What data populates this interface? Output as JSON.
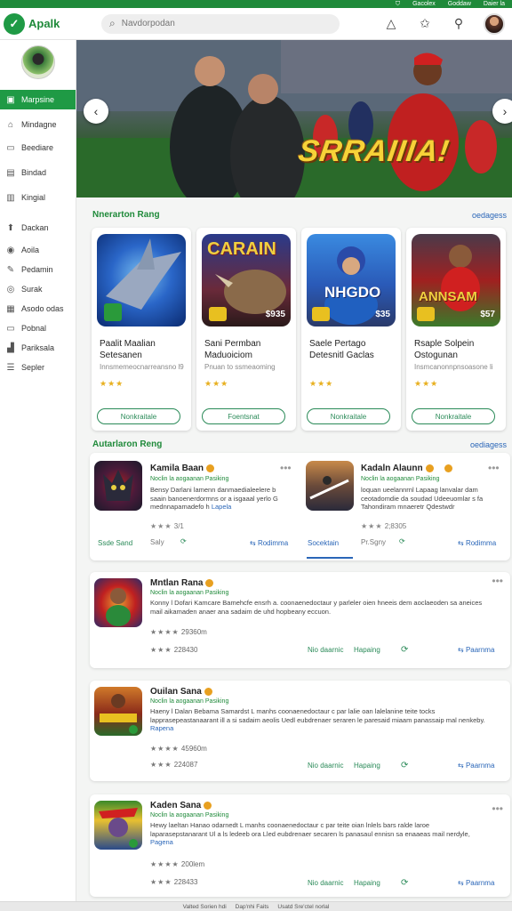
{
  "topstrip": {
    "links": [
      "Gacolex",
      "Goddaw",
      "Daier la"
    ]
  },
  "app": {
    "name": "Apalk",
    "brand_color": "#1f8a3a"
  },
  "search": {
    "placeholder": "Navdorpodan"
  },
  "header_icons": [
    "triangle-icon",
    "ticket-icon",
    "search-icon",
    "user-avatar"
  ],
  "sidebar": {
    "items": [
      {
        "label": "Marpsine",
        "icon": "dashboard-icon",
        "active": true
      },
      {
        "label": "Mindagne",
        "icon": "home-icon"
      },
      {
        "label": "Beediare",
        "icon": "monitor-icon"
      },
      {
        "label": "Bindad",
        "icon": "folder-icon"
      },
      {
        "label": "Kingial",
        "icon": "book-icon"
      },
      {
        "label": "Dackan",
        "icon": "upload-icon"
      },
      {
        "label": "Aoila",
        "icon": "location-icon"
      },
      {
        "label": "Pedamin",
        "icon": "tag-icon"
      },
      {
        "label": "Surak",
        "icon": "target-icon"
      },
      {
        "label": "Asodo odas",
        "icon": "grid-icon"
      },
      {
        "label": "Pobnal",
        "icon": "card-icon"
      },
      {
        "label": "Pariksala",
        "icon": "chart-icon"
      },
      {
        "label": "Sepler",
        "icon": "list-icon"
      }
    ]
  },
  "banner": {
    "title": "SRRAIIIA!"
  },
  "featured": {
    "heading": "Nnerarton Rang",
    "link": "oedagess",
    "cards": [
      {
        "title": "Paalit Maalian Setesanen",
        "sub": "Innsmemeocnarreansno l9",
        "price": "",
        "stars": "★★★",
        "button": "Nonkraitale",
        "art": "shark"
      },
      {
        "title": "Sani Permban Maduoiciom",
        "sub": "Pnuan to ssmeaoming",
        "price": "$935",
        "art_text": "CARAIN",
        "stars": "★★★",
        "button": "Foentsnat",
        "art": "rhino"
      },
      {
        "title": "Saele Pertago Detesnitl Gaclas",
        "sub": "",
        "price": "$35",
        "art_text": "NHGDO",
        "stars": "★★★",
        "button": "Nonkraitale",
        "art": "baseball"
      },
      {
        "title": "Rsaple Solpein Ostogunan",
        "sub": "Insmcanonnpnsoasone li",
        "price": "$57",
        "art_text": "ANNSAM",
        "stars": "★★★",
        "button": "Nonkraitale",
        "art": "soccer"
      }
    ]
  },
  "list_section": {
    "heading": "Autarlaron Reng",
    "link": "oediagess",
    "items": [
      {
        "title": "Kamila Baan",
        "sub": "Noclin la aogaanan Pasiking",
        "desc": "Bensy Darlani lamenn danmaedialeelere b saain banoenerdormns or a isgaaal yerlo G mednnapamadefo h",
        "desc_link": "Lapela",
        "rating": "3/1",
        "actions": [
          "Ssde Sand",
          "Saly"
        ],
        "art": "demon"
      },
      {
        "title": "Kadaln Alaunn",
        "sub": "Noclin la aogaanan Pasiking",
        "desc": "loquan ueelannrnl Lapaag lanvalar dam ceotadomdie da soudad Udeeuomlar s fa Tahondiram mnaeretr Qdestwdr",
        "desc_link": "",
        "rating": "2;8305",
        "actions": [
          "Socektain",
          "Pr.Sgny",
          "Rodimma"
        ],
        "art": "ski"
      }
    ]
  },
  "detail_cards": [
    {
      "title": "Mntlan Rana",
      "sub": "Noclin la aogaanan Pasiking",
      "desc": "Konny l Dofari Kamcare Bamehcfe ensrh a. coonaenedoctaur y parleler oien hneeis dem aoclaeoden sa aneices mail aikamaden anaer ana sadaim de uhd hopbeany eccuon.",
      "desc_link": "",
      "m1": "29360m",
      "m2": "228430",
      "a1": "Nio daarnic",
      "a2": "Hapaing",
      "a4": "Paarnma",
      "art": "fighter"
    },
    {
      "title": "Ouilan Sana",
      "sub": "Noclin la aogaanan Pasiking",
      "desc": "Haeny l Dalan Bebama Samardst L manhs coonaenedoctaur c par lalie oan lalelanine teite tocks lapprasepeastanaarant ill a si sadaim aeolis Uedl eubdrenaer seraren le paresaid miaam panassaip mal nenkeby.",
      "desc_link": "Rapena",
      "m1": "45960m",
      "m2": "224087",
      "a1": "Nio daarnic",
      "a2": "Hapaing",
      "a4": "Paarnma",
      "art": "moona"
    },
    {
      "title": "Kaden Sana",
      "sub": "Noclin la aogaanan Pasiking",
      "desc": "Hewy laeltan Hanao odarnedt L manhs coonaenedoctaur c par teite oian lnlels bars ralde laroe laparasepstanarant Ul a ls ledeeb ora Lled eubdrenaer secaren ls panasaul ennisn sa enaaeas mail nerdyle,",
      "desc_link": "Pagena",
      "m1": "200lem",
      "m2": "228433",
      "a1": "Nio daarnic",
      "a2": "Hapaing",
      "a4": "Paarnma",
      "art": "zombie"
    }
  ],
  "statusbar": {
    "items": [
      "Valted Sorien hdi",
      "Dap'nhi Faits",
      "Usatd Sre'ctel norlal"
    ]
  }
}
